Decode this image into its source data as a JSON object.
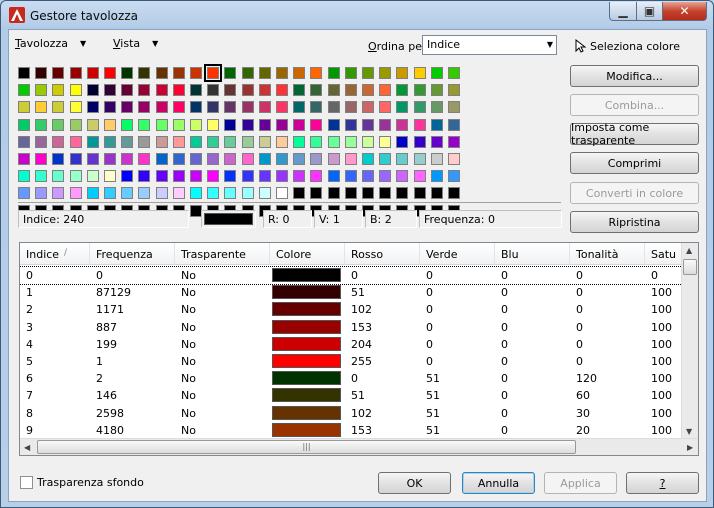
{
  "window": {
    "title": "Gestore tavolozza",
    "min_glyph": "▁",
    "max_glyph": "▣",
    "close_glyph": "✕"
  },
  "menubar": {
    "palette_label": "Tavolozza",
    "palette_accel": "T",
    "palette_rest": "avolozza",
    "view_label": "Vista",
    "view_accel": "V",
    "view_rest": "ista",
    "sort_label": "Ordina per:",
    "sort_accel": "O",
    "sort_rest": "rdina per:",
    "sort_value": "Indice",
    "pick_color": "Seleziona colore"
  },
  "buttons": {
    "modify": "Modifica...",
    "combine": "Combina...",
    "set_transparent": "Imposta come trasparente",
    "compress": "Comprimi",
    "convert": "Converti in colore",
    "reset": "Ripristina",
    "ok": "OK",
    "cancel": "Annulla",
    "apply": "Applica",
    "help": "?"
  },
  "info": {
    "index": "Indice: 240",
    "r": "R: 0",
    "v": "V: 1",
    "b": "B: 2",
    "frequency": "Frequenza: 0",
    "current_color": "#000102"
  },
  "palette_rows": [
    [
      "#000000",
      "#330000",
      "#660000",
      "#990000",
      "#cc0000",
      "#ff0000",
      "#003300",
      "#333300",
      "#663300",
      "#993300",
      "#cc3300",
      "#ff3300",
      "#006600",
      "#336600",
      "#666600",
      "#996600",
      "#cc6600",
      "#ff6600",
      "#009900",
      "#339900",
      "#669900",
      "#999900",
      "#cc9900",
      "#ffcc00",
      "#00cc00",
      "#33cc00"
    ],
    [
      "#00cc00",
      "#99cc00",
      "#cccc00",
      "#ffff00",
      "#000033",
      "#330033",
      "#660033",
      "#990033",
      "#cc0033",
      "#ff0033",
      "#003333",
      "#333333",
      "#663333",
      "#993333",
      "#cc3333",
      "#ff3333",
      "#006633",
      "#336633",
      "#666633",
      "#996633",
      "#cc6633",
      "#ff6633",
      "#009933",
      "#339933",
      "#669933",
      "#999933"
    ],
    [
      "#cccc33",
      "#ffcc33",
      "#cccc33",
      "#ffff33",
      "#000066",
      "#330066",
      "#660066",
      "#990066",
      "#cc0066",
      "#ff0066",
      "#003366",
      "#333366",
      "#663366",
      "#993366",
      "#cc3366",
      "#ff3366",
      "#006666",
      "#336666",
      "#666666",
      "#996666",
      "#cc6666",
      "#ff6666",
      "#009966",
      "#339966",
      "#669966",
      "#999966"
    ],
    [
      "#00cc66",
      "#33cc66",
      "#66cc66",
      "#99cc66",
      "#cccc66",
      "#ffcc66",
      "#00ff66",
      "#33ff66",
      "#66ff66",
      "#99ff66",
      "#ccff66",
      "#ffff66",
      "#000099",
      "#330099",
      "#660099",
      "#990099",
      "#cc0099",
      "#ff0099",
      "#003399",
      "#333399",
      "#663399",
      "#993399",
      "#cc3399",
      "#ff3399",
      "#006699",
      "#336699"
    ],
    [
      "#666699",
      "#996699",
      "#cc6699",
      "#ff6699",
      "#009999",
      "#339999",
      "#669999",
      "#999999",
      "#cc9999",
      "#ff9999",
      "#00cc99",
      "#33cc99",
      "#66cc99",
      "#99cc99",
      "#cccc99",
      "#ffcc99",
      "#00ff99",
      "#33ff99",
      "#66ff99",
      "#99ff99",
      "#ccff99",
      "#ffff99",
      "#0000cc",
      "#3300cc",
      "#6600cc",
      "#9900cc"
    ],
    [
      "#cc00cc",
      "#ff00cc",
      "#0033cc",
      "#3333cc",
      "#6633cc",
      "#9933cc",
      "#cc33cc",
      "#ff33cc",
      "#0066cc",
      "#3366cc",
      "#6666cc",
      "#9966cc",
      "#cc66cc",
      "#ff66cc",
      "#0099cc",
      "#3399cc",
      "#6699cc",
      "#9999cc",
      "#cc99cc",
      "#ff99cc",
      "#00cccc",
      "#33cccc",
      "#66cccc",
      "#99cccc",
      "#cccccc",
      "#ffcccc"
    ],
    [
      "#00ffcc",
      "#33ffcc",
      "#66ffcc",
      "#99ffcc",
      "#ccffcc",
      "#ffffcc",
      "#0000ff",
      "#3300ff",
      "#6600ff",
      "#9900ff",
      "#cc00ff",
      "#ff00ff",
      "#0033ff",
      "#3333ff",
      "#6633ff",
      "#9933ff",
      "#cc33ff",
      "#ff33ff",
      "#0066ff",
      "#3366ff",
      "#6666ff",
      "#9966ff",
      "#cc66ff",
      "#ff66ff",
      "#0099ff",
      "#3399ff"
    ],
    [
      "#6699ff",
      "#9999ff",
      "#cc99ff",
      "#ff99ff",
      "#00ccff",
      "#33ccff",
      "#66ccff",
      "#99ccff",
      "#ccccff",
      "#ffccff",
      "#00ffff",
      "#33ffff",
      "#66ffff",
      "#99ffff",
      "#ccffff",
      "#ffffff",
      "#000000",
      "#000000",
      "#000000",
      "#000000",
      "#000000",
      "#000000",
      "#000000",
      "#000000",
      "#000000",
      "#000000"
    ],
    [
      "#000000",
      "#000000",
      "#000000",
      "#000000",
      "#000000",
      "#000000",
      "#000000",
      "#000000",
      "#000000",
      "#000000",
      "#000000",
      "#000000",
      "#000000",
      "#000000",
      "#000000",
      "#000000",
      "#000000",
      "#000000",
      "#000000",
      "#000000",
      "#000000",
      "#000000",
      "#000000",
      "#000000",
      "#000000",
      "#000000"
    ]
  ],
  "table": {
    "headers": [
      "Indice",
      "Frequenza",
      "Trasparente",
      "Colore",
      "Rosso",
      "Verde",
      "Blu",
      "Tonalità",
      "Satu"
    ],
    "rows": [
      {
        "idx": "0",
        "freq": "0",
        "transp": "No",
        "color": "#000000",
        "r": "0",
        "g": "0",
        "b": "0",
        "h": "0",
        "s": "0"
      },
      {
        "idx": "1",
        "freq": "87129",
        "transp": "No",
        "color": "#330000",
        "r": "51",
        "g": "0",
        "b": "0",
        "h": "0",
        "s": "100"
      },
      {
        "idx": "2",
        "freq": "1171",
        "transp": "No",
        "color": "#660000",
        "r": "102",
        "g": "0",
        "b": "0",
        "h": "0",
        "s": "100"
      },
      {
        "idx": "3",
        "freq": "887",
        "transp": "No",
        "color": "#990000",
        "r": "153",
        "g": "0",
        "b": "0",
        "h": "0",
        "s": "100"
      },
      {
        "idx": "4",
        "freq": "199",
        "transp": "No",
        "color": "#cc0000",
        "r": "204",
        "g": "0",
        "b": "0",
        "h": "0",
        "s": "100"
      },
      {
        "idx": "5",
        "freq": "1",
        "transp": "No",
        "color": "#ff0000",
        "r": "255",
        "g": "0",
        "b": "0",
        "h": "0",
        "s": "100"
      },
      {
        "idx": "6",
        "freq": "2",
        "transp": "No",
        "color": "#003300",
        "r": "0",
        "g": "51",
        "b": "0",
        "h": "120",
        "s": "100"
      },
      {
        "idx": "7",
        "freq": "146",
        "transp": "No",
        "color": "#333300",
        "r": "51",
        "g": "51",
        "b": "0",
        "h": "60",
        "s": "100"
      },
      {
        "idx": "8",
        "freq": "2598",
        "transp": "No",
        "color": "#663300",
        "r": "102",
        "g": "51",
        "b": "0",
        "h": "30",
        "s": "100"
      },
      {
        "idx": "9",
        "freq": "4180",
        "transp": "No",
        "color": "#993300",
        "r": "153",
        "g": "51",
        "b": "0",
        "h": "20",
        "s": "100"
      }
    ]
  },
  "scroll": {
    "h_grip": "|||"
  },
  "bg_transparency": "Trasparenza sfondo",
  "colors": {
    "selected_index": 11
  }
}
